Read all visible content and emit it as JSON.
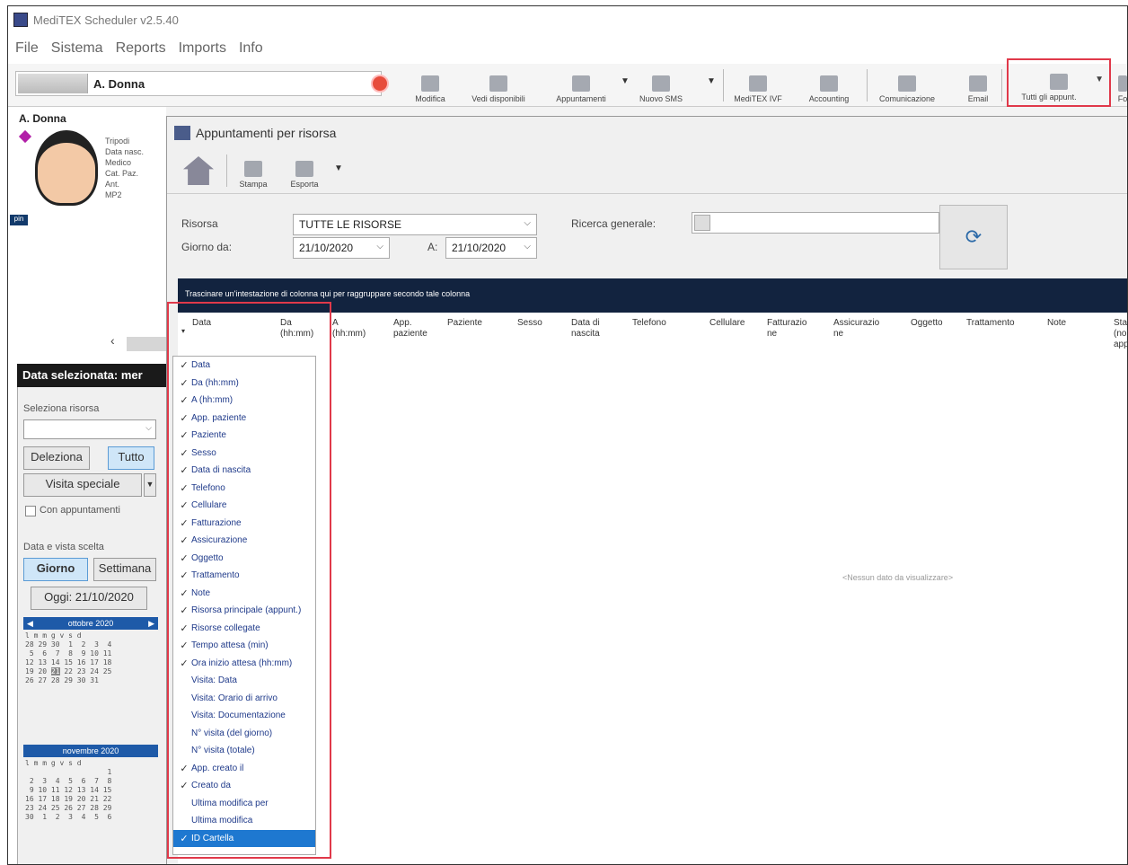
{
  "window": {
    "title": "MediTEX Scheduler v2.5.40"
  },
  "menu": [
    "File",
    "Sistema",
    "Reports",
    "Imports",
    "Info"
  ],
  "patient": {
    "name": "A. Donna"
  },
  "toolbar": {
    "buttons": [
      {
        "id": "modifica",
        "label": "Modifica"
      },
      {
        "id": "vedi-disponibili",
        "label": "Vedi disponibili"
      },
      {
        "id": "appuntamenti",
        "label": "Appuntamenti"
      },
      {
        "id": "nuovo-sms",
        "label": "Nuovo SMS"
      },
      {
        "id": "meditex-ivf",
        "label": "MediTEX IVF"
      },
      {
        "id": "accounting",
        "label": "Accounting"
      },
      {
        "id": "comunicazione",
        "label": "Comunicazione"
      },
      {
        "id": "email",
        "label": "Email"
      },
      {
        "id": "tutti-appuntamenti",
        "label": "Tutti gli appunt."
      },
      {
        "id": "overflow",
        "label": "Fo"
      }
    ]
  },
  "left_pane": {
    "patient_label": "A. Donna",
    "info_labels": [
      "Tripodi",
      "Data nasc.",
      "Medico",
      "Cat. Paz.",
      "Ant.",
      "MP2"
    ],
    "badge": "pin",
    "date_header": "Data selezionata: mer",
    "resource_label": "Seleziona risorsa",
    "btn_deselect": "Deleziona",
    "btn_all": "Tutto",
    "special_view": "Visita speciale",
    "checkbox_label": "Con appuntamenti",
    "view_label": "Data e vista scelta",
    "btn_day": "Giorno",
    "btn_week": "Settimana",
    "today": "Oggi: 21/10/2020",
    "month1": "ottobre 2020",
    "month2": "novembre 2020",
    "dow": "l m m g v s d"
  },
  "dialog": {
    "title": "Appuntamenti per risorsa",
    "tb_print": "Stampa",
    "tb_export": "Esporta",
    "resource_label": "Risorsa",
    "resource_value": "TUTTE LE RISORSE",
    "period_label": "Giorno da:",
    "date_from": "21/10/2020",
    "to_label": "A:",
    "date_to": "21/10/2020",
    "search_label": "Ricerca generale:",
    "banner": "Trascinare un'intestazione di colonna qui per raggruppare secondo tale colonna",
    "columns": [
      "Data",
      "Da\n(hh:mm)",
      "A\n(hh:mm)",
      "App.\npaziente",
      "Paziente",
      "Sesso",
      "Data di\nnascita",
      "Telefono",
      "Cellulare",
      "Fatturazio\nne",
      "Assicurazio\nne",
      "Oggetto",
      "Trattamento",
      "Note",
      "Sta\n(no\napp"
    ],
    "empty_text": "<Nessun dato da visualizzare>"
  },
  "column_menu": [
    {
      "label": "Data",
      "checked": true
    },
    {
      "label": "Da (hh:mm)",
      "checked": true
    },
    {
      "label": "A (hh:mm)",
      "checked": true
    },
    {
      "label": "App. paziente",
      "checked": true
    },
    {
      "label": "Paziente",
      "checked": true
    },
    {
      "label": "Sesso",
      "checked": true
    },
    {
      "label": "Data di nascita",
      "checked": true
    },
    {
      "label": "Telefono",
      "checked": true
    },
    {
      "label": "Cellulare",
      "checked": true
    },
    {
      "label": "Fatturazione",
      "checked": true
    },
    {
      "label": "Assicurazione",
      "checked": true
    },
    {
      "label": "Oggetto",
      "checked": true
    },
    {
      "label": "Trattamento",
      "checked": true
    },
    {
      "label": "Note",
      "checked": true
    },
    {
      "label": "Risorsa principale (appunt.)",
      "checked": true
    },
    {
      "label": "Risorse collegate",
      "checked": true
    },
    {
      "label": "Tempo attesa (min)",
      "checked": true
    },
    {
      "label": "Ora inizio attesa (hh:mm)",
      "checked": true
    },
    {
      "label": "Visita: Data",
      "checked": false
    },
    {
      "label": "Visita: Orario di arrivo",
      "checked": false
    },
    {
      "label": "Visita: Documentazione",
      "checked": false
    },
    {
      "label": "N° visita (del giorno)",
      "checked": false
    },
    {
      "label": "N° visita (totale)",
      "checked": false
    },
    {
      "label": "App. creato il",
      "checked": true
    },
    {
      "label": "Creato da",
      "checked": true
    },
    {
      "label": "Ultima modifica per",
      "checked": false
    },
    {
      "label": "Ultima modifica",
      "checked": false
    },
    {
      "label": "ID Cartella",
      "checked": true,
      "selected": true
    }
  ]
}
